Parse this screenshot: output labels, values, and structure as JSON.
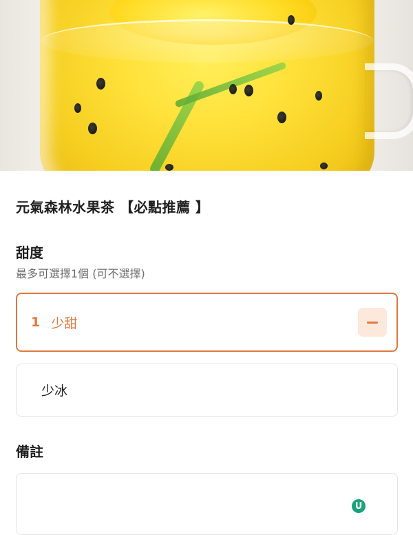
{
  "item": {
    "title": "元氣森林水果茶 【必點推薦 】"
  },
  "sweetness": {
    "title": "甜度",
    "subtitle": "最多可選擇1個 (可不選擇)",
    "options": [
      {
        "label": "少甜",
        "quantity": "1",
        "selected": true
      },
      {
        "label": "少冰",
        "quantity": "",
        "selected": false
      }
    ]
  },
  "notes": {
    "title": "備註",
    "value": ""
  },
  "icons": {
    "decrement": "minus-icon",
    "brand": "u-brand-logo"
  },
  "colors": {
    "accent": "#e2773c",
    "accent_soft": "#fde8dc",
    "border": "#e4e4e4",
    "subtext": "#6e6e6e"
  }
}
